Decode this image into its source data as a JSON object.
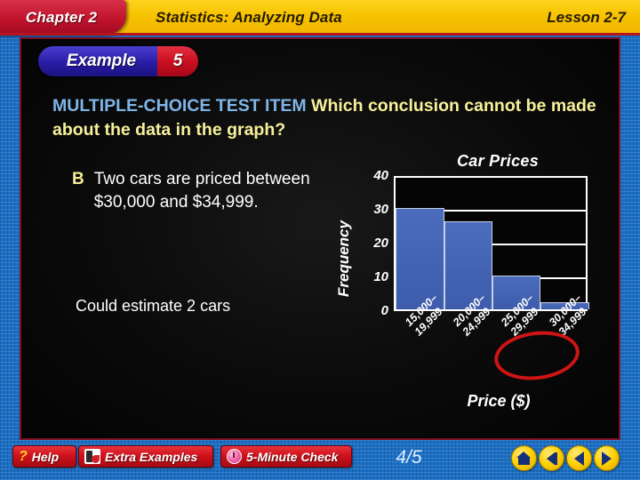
{
  "header": {
    "chapter": "Chapter 2",
    "title": "Statistics: Analyzing Data",
    "lesson": "Lesson 2-7"
  },
  "slide": {
    "example_badge": {
      "word": "Example",
      "number": "5"
    },
    "question": {
      "lead_in": "MULTIPLE-CHOICE TEST ITEM",
      "body": " Which conclusion cannot be made about the data in the graph?"
    },
    "choice": {
      "letter": "B",
      "text": "Two cars are priced between $30,000 and $34,999."
    },
    "note": "Could estimate 2 cars"
  },
  "chart_data": {
    "type": "bar",
    "title": "Car Prices",
    "xlabel": "Price ($)",
    "ylabel": "Frequency",
    "categories": [
      "15,000–\n19,999",
      "20,000–\n24,999",
      "25,000–\n29,999",
      "30,000–\n34,999"
    ],
    "category_lines": [
      [
        "15,000–",
        "19,999"
      ],
      [
        "20,000–",
        "24,999"
      ],
      [
        "25,000–",
        "29,999"
      ],
      [
        "30,000–",
        "34,999"
      ]
    ],
    "values": [
      30,
      26,
      10,
      2
    ],
    "ylim": [
      0,
      40
    ],
    "yticks": [
      40,
      30,
      20,
      10,
      0
    ],
    "grid": true,
    "legend": "none",
    "bar_color": "#3d5cab",
    "annotations": [
      {
        "type": "ellipse",
        "color": "#cf1414",
        "target": "30,000–34,999",
        "note": "highlighted x-axis category"
      }
    ]
  },
  "toolbar": {
    "help_label": "Help",
    "extra_examples_label": "Extra Examples",
    "five_minute_check_label": "5-Minute Check",
    "page": "4/5"
  }
}
